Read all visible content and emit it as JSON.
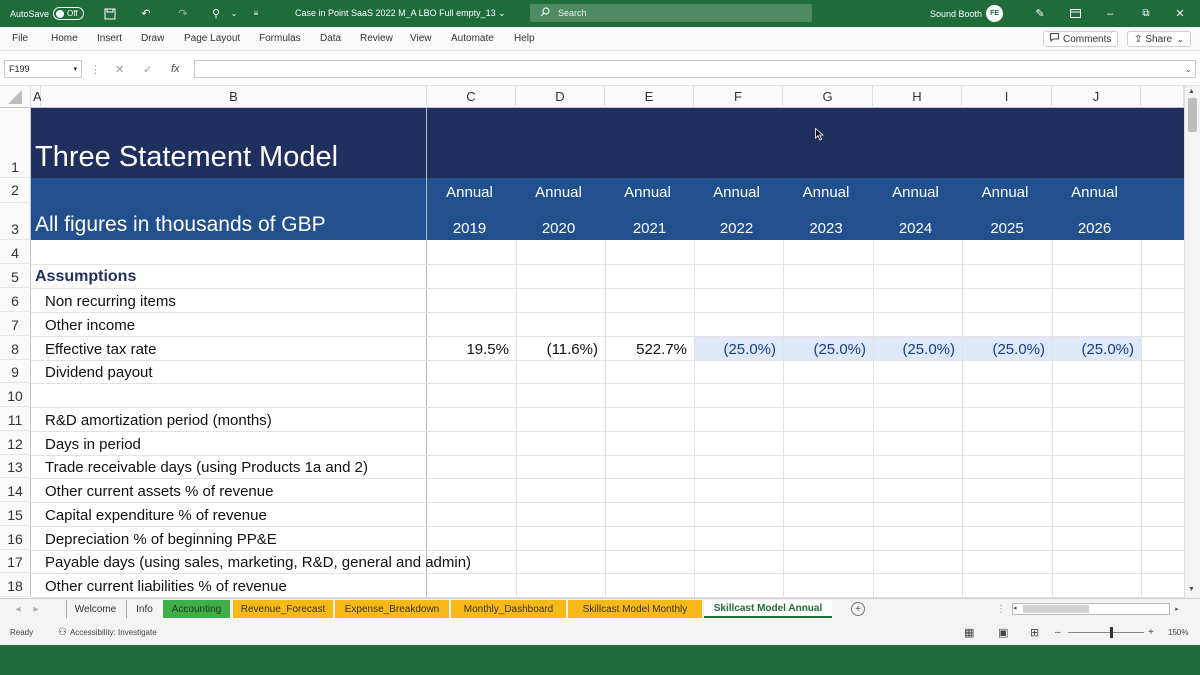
{
  "titlebar": {
    "autosave_label": "AutoSave",
    "autosave_state": "Off",
    "doc_title": "Case in Point SaaS 2022 M_A LBO Full empty_13 ⌄",
    "search_placeholder": "Search",
    "user_name": "Sound Booth",
    "avatar_initials": "FE"
  },
  "menu": {
    "items": [
      "File",
      "Home",
      "Insert",
      "Draw",
      "Page Layout",
      "Formulas",
      "Data",
      "Review",
      "View",
      "Automate",
      "Help"
    ],
    "comments_label": "Comments",
    "share_label": "Share"
  },
  "formula_bar": {
    "name_box": "F199",
    "fx_label": "fx",
    "formula": ""
  },
  "columns": [
    "A",
    "B",
    "C",
    "D",
    "E",
    "F",
    "G",
    "H",
    "I",
    "J"
  ],
  "rows": [
    "1",
    "2",
    "3",
    "4",
    "5",
    "6",
    "7",
    "8",
    "9",
    "10",
    "11",
    "12",
    "13",
    "14",
    "15",
    "16",
    "17",
    "18"
  ],
  "sheet": {
    "title": "Three Statement Model",
    "subtitle": "All figures in thousands of GBP",
    "period_type": [
      "Annual",
      "Annual",
      "Annual",
      "Annual",
      "Annual",
      "Annual",
      "Annual",
      "Annual"
    ],
    "years": [
      "2019",
      "2020",
      "2021",
      "2022",
      "2023",
      "2024",
      "2025",
      "2026"
    ],
    "section_assumptions": "Assumptions",
    "labels": {
      "r6": "Non recurring items",
      "r7": "Other income",
      "r8": "Effective tax rate",
      "r9": "Dividend payout",
      "r11": "R&D amortization period (months)",
      "r12": "Days in period",
      "r13": "Trade receivable days (using Products 1a and 2)",
      "r14": "Other current assets % of revenue",
      "r15": "Capital expenditure % of revenue",
      "r16": "Depreciation % of beginning PP&E",
      "r17": "Payable days (using sales, marketing, R&D, general and admin)",
      "r18": "Other current liabilities % of revenue"
    },
    "tax_rate": [
      "19.5%",
      "(11.6%)",
      "522.7%",
      "(25.0%)",
      "(25.0%)",
      "(25.0%)",
      "(25.0%)",
      "(25.0%)"
    ]
  },
  "tabs": [
    "Welcome",
    "Info",
    "Accounting",
    "Revenue_Forecast",
    "Expense_Breakdown",
    "Monthly_Dashboard",
    "Skillcast Model Monthly",
    "Skillcast Model Annual"
  ],
  "status": {
    "ready": "Ready",
    "accessibility": "Accessibility: Investigate",
    "zoom": "150%"
  },
  "colors": {
    "title_navy": "#1f2f5e",
    "header_blue": "#22508f",
    "input_blue_text": "#1a3c8a",
    "input_fill": "#dde9f8",
    "excel_green": "#1f6b3a",
    "tab_green": "#3fae4a",
    "tab_orange": "#f7b917"
  }
}
